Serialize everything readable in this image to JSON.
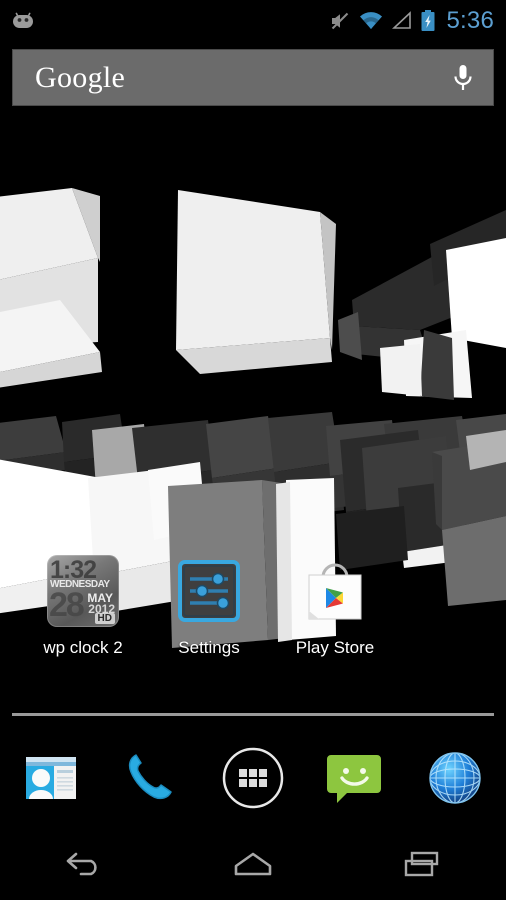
{
  "statusbar": {
    "notification_icon": "android-robot-icon",
    "icons": [
      "mute-icon",
      "wifi-icon",
      "signal-icon",
      "battery-charging-icon"
    ],
    "clock": "5:36",
    "clock_color": "#5c9fd1"
  },
  "search": {
    "label": "Google",
    "mic_icon": "microphone-icon",
    "background": "#6b6b6b"
  },
  "apps": [
    {
      "name": "wp clock 2",
      "icon": "wp-clock-widget-icon",
      "icon_text": {
        "time": "1:32",
        "weekday": "WEDNESDAY",
        "day": "28",
        "month": "MAY",
        "year": "2012",
        "badge": "HD"
      }
    },
    {
      "name": "Settings",
      "icon": "settings-sliders-icon"
    },
    {
      "name": "Play Store",
      "icon": "play-store-bag-icon"
    }
  ],
  "dock": [
    {
      "name": "People",
      "icon": "contacts-icon"
    },
    {
      "name": "Phone",
      "icon": "phone-icon"
    },
    {
      "name": "Apps",
      "icon": "app-drawer-icon"
    },
    {
      "name": "Messaging",
      "icon": "messaging-icon"
    },
    {
      "name": "Browser",
      "icon": "browser-globe-icon"
    }
  ],
  "navbar": [
    {
      "name": "Back",
      "icon": "back-arrow-icon"
    },
    {
      "name": "Home",
      "icon": "home-icon"
    },
    {
      "name": "Recents",
      "icon": "recent-apps-icon"
    }
  ],
  "wallpaper": {
    "name": "3d-cubes-live-wallpaper",
    "background": "#000000"
  }
}
